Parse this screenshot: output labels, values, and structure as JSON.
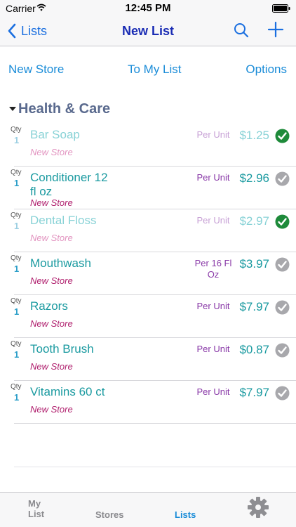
{
  "status_bar": {
    "carrier": "Carrier",
    "time": "12:45 PM"
  },
  "nav": {
    "back_label": "Lists",
    "title": "New List"
  },
  "toolbar": {
    "new_store": "New Store",
    "to_my_list": "To My List",
    "options": "Options"
  },
  "section": {
    "title": "Health & Care"
  },
  "qty_label": "Qty",
  "items": [
    {
      "qty": "1",
      "name": "Bar Soap",
      "store": "New Store",
      "unit": "Per Unit",
      "price": "$1.25",
      "checked": true
    },
    {
      "qty": "1",
      "name": "Conditioner 12 fl oz",
      "store": "New Store",
      "unit": "Per Unit",
      "price": "$2.96",
      "checked": false
    },
    {
      "qty": "1",
      "name": "Dental Floss",
      "store": "New Store",
      "unit": "Per Unit",
      "price": "$2.97",
      "checked": true
    },
    {
      "qty": "1",
      "name": "Mouthwash",
      "store": "New Store",
      "unit": "Per 16 Fl Oz",
      "price": "$3.97",
      "checked": false
    },
    {
      "qty": "1",
      "name": "Razors",
      "store": "New Store",
      "unit": "Per Unit",
      "price": "$7.97",
      "checked": false
    },
    {
      "qty": "1",
      "name": "Tooth Brush",
      "store": "New Store",
      "unit": "Per Unit",
      "price": "$0.87",
      "checked": false
    },
    {
      "qty": "1",
      "name": "Vitamins 60 ct",
      "store": "New Store",
      "unit": "Per Unit",
      "price": "$7.97",
      "checked": false
    }
  ],
  "tabs": {
    "my_list": "My List",
    "stores": "Stores",
    "lists": "Lists"
  },
  "colors": {
    "accent": "#1a8cd8",
    "nav_title": "#1a2cb4",
    "section": "#5a6a8e",
    "item": "#1a9aa0",
    "store": "#b0206e",
    "unit": "#8a3aa8",
    "check_on": "#1e8a3a",
    "check_off": "#a8a8ac"
  },
  "icons": [
    "wifi-icon",
    "battery-icon",
    "chevron-left-icon",
    "search-icon",
    "plus-icon",
    "disclosure-triangle-icon",
    "checkmark-icon",
    "gear-icon"
  ]
}
